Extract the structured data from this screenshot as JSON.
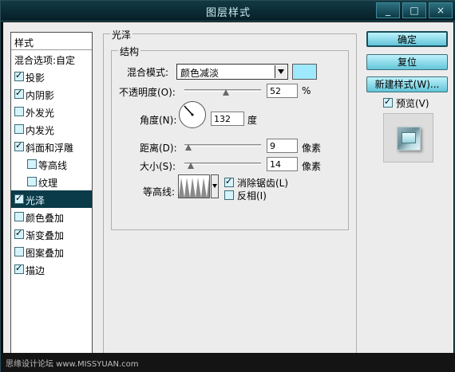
{
  "window": {
    "title": "图层样式",
    "min_label": "_",
    "max_label": "□",
    "close_label": "×"
  },
  "list": {
    "header": "样式",
    "blend_label": "混合选项:自定",
    "items": [
      {
        "label": "投影",
        "checked": true
      },
      {
        "label": "内阴影",
        "checked": true
      },
      {
        "label": "外发光",
        "checked": false
      },
      {
        "label": "内发光",
        "checked": false
      },
      {
        "label": "斜面和浮雕",
        "checked": true
      },
      {
        "label": "等高线",
        "checked": false,
        "sub": true
      },
      {
        "label": "纹理",
        "checked": false,
        "sub": true
      },
      {
        "label": "光泽",
        "checked": true,
        "selected": true
      },
      {
        "label": "颜色叠加",
        "checked": false
      },
      {
        "label": "渐变叠加",
        "checked": true
      },
      {
        "label": "图案叠加",
        "checked": false
      },
      {
        "label": "描边",
        "checked": true
      }
    ]
  },
  "panel": {
    "section_title": "光泽",
    "group_title": "结构",
    "blend_mode_label": "混合模式:",
    "blend_mode_value": "颜色减淡",
    "swatch_color": "#9fe9ff",
    "opacity_label": "不透明度(O):",
    "opacity_value": "52",
    "opacity_unit": "%",
    "angle_label": "角度(N):",
    "angle_value": "132",
    "angle_unit": "度",
    "distance_label": "距离(D):",
    "distance_value": "9",
    "distance_unit": "像素",
    "size_label": "大小(S):",
    "size_value": "14",
    "size_unit": "像素",
    "contour_label": "等高线:",
    "anti_alias_label": "消除锯齿(L)",
    "anti_alias_checked": true,
    "invert_label": "反相(I)",
    "invert_checked": false
  },
  "buttons": {
    "ok": "确定",
    "reset": "复位",
    "new_style": "新建样式(W)...",
    "preview_label": "预览(V)",
    "preview_checked": true
  },
  "footer": {
    "watermark": "思缘设计论坛 www.MISSYUAN.com"
  },
  "colors": {
    "selection": "#0a3b48",
    "button": "#62c5d8",
    "accent": "#9fe9ff"
  }
}
